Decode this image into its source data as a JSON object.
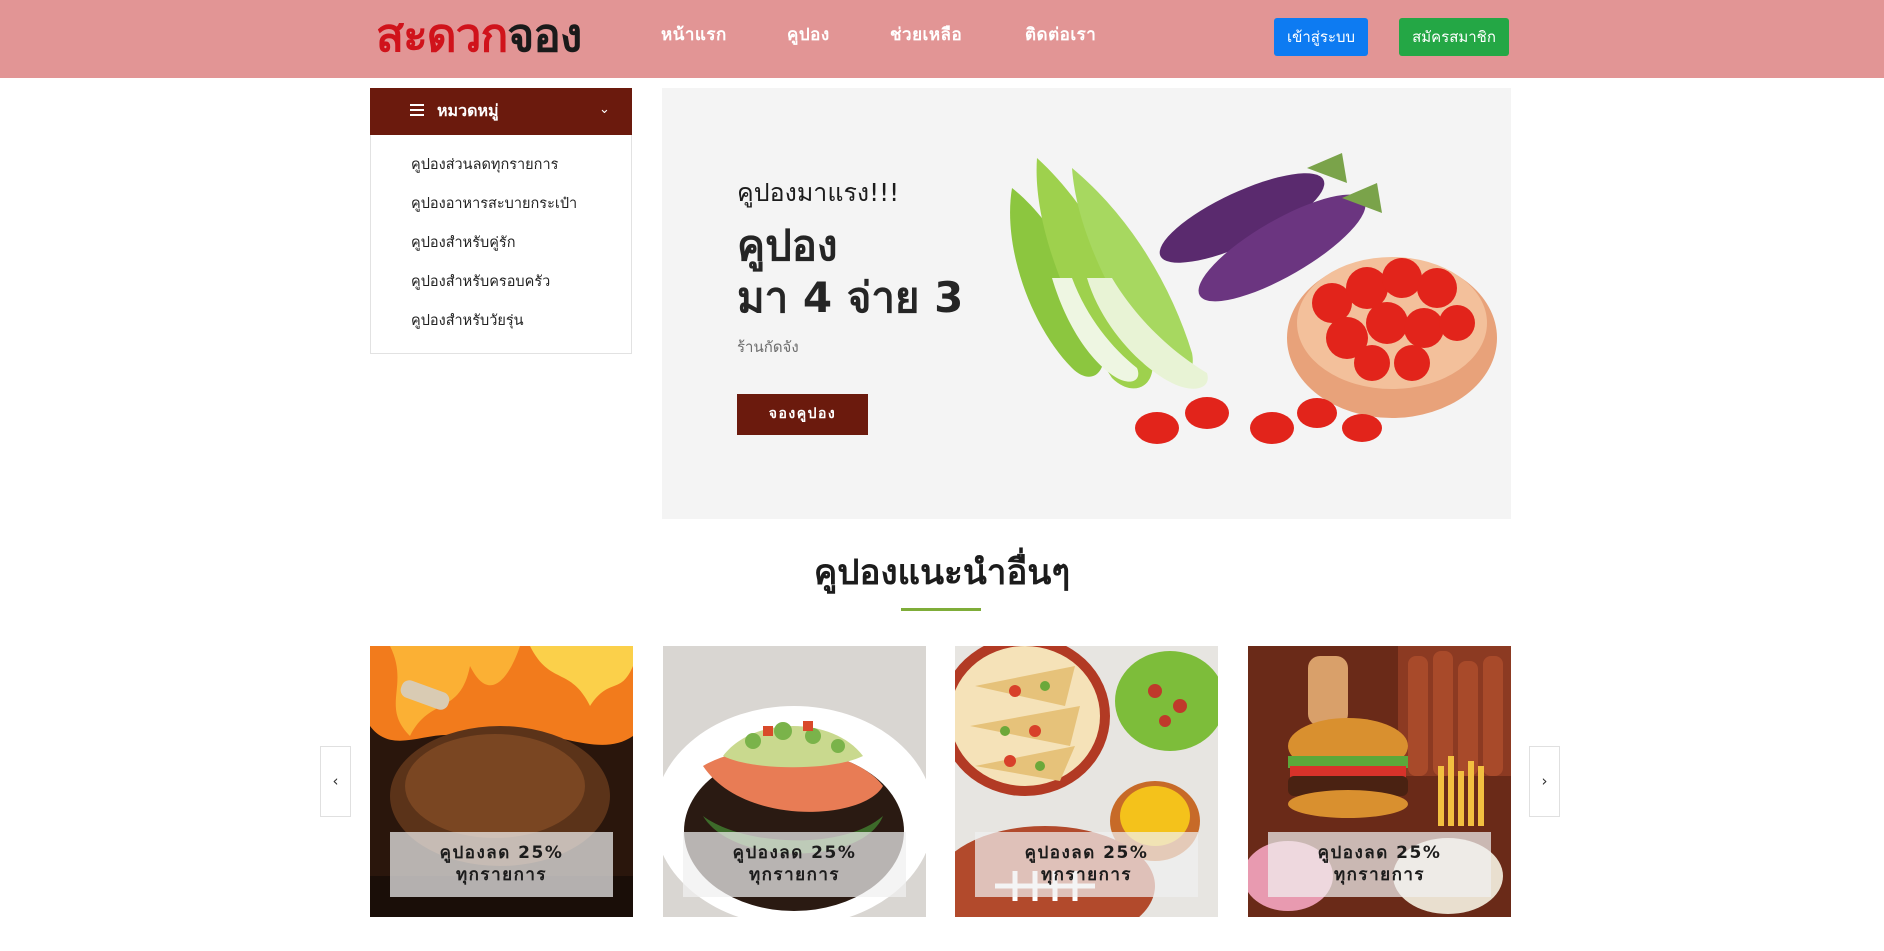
{
  "header": {
    "logo_part1": "สะดวก",
    "logo_part2": "จอง",
    "nav": [
      "หน้าแรก",
      "คูปอง",
      "ช่วยเหลือ",
      "ติดต่อเรา"
    ],
    "login_label": "เข้าสู่ระบบ",
    "signup_label": "สมัครสมาชิก"
  },
  "sidebar": {
    "title": "หมวดหมู่",
    "items": [
      "คูปองส่วนลดทุกรายการ",
      "คูปองอาหารสะบายกระเป๋า",
      "คูปองสำหรับคู่รัก",
      "คูปองสำหรับครอบครัว",
      "คูปองสำหรับวัยรุ่น"
    ]
  },
  "hero": {
    "eyebrow": "คูปองมาแรง!!!",
    "headline_line1": "คูปอง",
    "headline_line2": "มา 4 จ่าย 3",
    "shop": "ร้านกัดจัง",
    "cta_label": "จองคูปอง"
  },
  "recommend": {
    "title": "คูปองแนะนำอื่นๆ",
    "cards": [
      {
        "line1": "คูปองลด 25%",
        "line2": "ทุกรายการ"
      },
      {
        "line1": "คูปองลด 25%",
        "line2": "ทุกรายการ"
      },
      {
        "line1": "คูปองลด 25%",
        "line2": "ทุกรายการ"
      },
      {
        "line1": "คูปองลด 25%",
        "line2": "ทุกรายการ"
      }
    ],
    "prev_icon": "chevron-left-icon",
    "next_icon": "chevron-right-icon"
  },
  "colors": {
    "header_bg": "#e29595",
    "brand_red": "#d0131b",
    "maroon": "#6b1a0d",
    "login_blue": "#0d7bf2",
    "signup_green": "#24a745",
    "accent_green": "#7fad39"
  }
}
